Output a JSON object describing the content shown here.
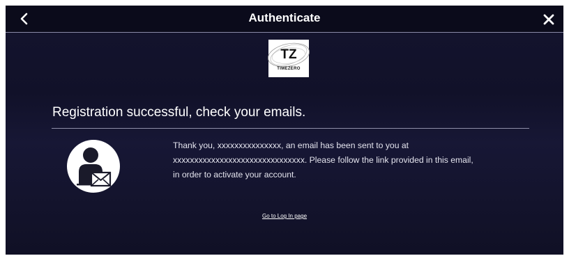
{
  "header": {
    "title": "Authenticate",
    "back_icon": "chevron-left-icon",
    "close_icon": "close-icon"
  },
  "logo": {
    "mark": "TZ",
    "wordmark": "TIMEZERO"
  },
  "main": {
    "headline": "Registration successful, check your emails.",
    "message": {
      "line1_prefix": "Thank you, ",
      "username": "xxxxxxxxxxxxxxx",
      "line1_suffix": ", an email has been sent to you at",
      "email": "xxxxxxxxxxxxxxxxxxxxxxxxxxxxxxx",
      "line2_suffix": ". Please follow the link provided in this email,",
      "line3": "in order to activate your account."
    },
    "avatar_icon": "user-email-icon",
    "login_link": "Go to Log In page"
  },
  "colors": {
    "background": "#14142f",
    "topbar": "#0b0b1b",
    "text": "#ffffff"
  }
}
